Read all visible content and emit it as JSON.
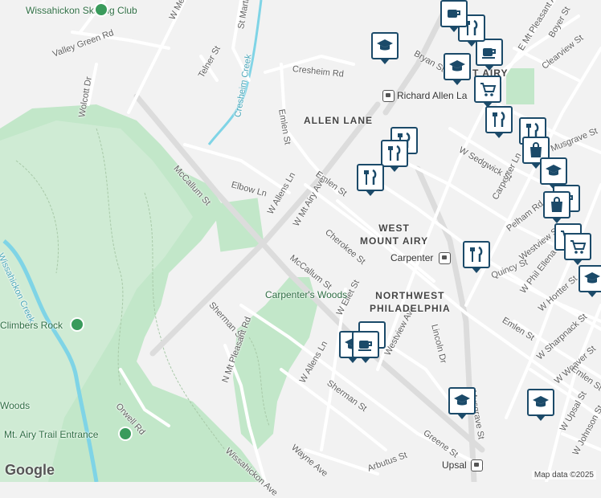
{
  "map": {
    "colors": {
      "park": "#c2e7c9",
      "park_light": "#d7efdc",
      "street": "#ffffff",
      "major": "#dcdcdc",
      "water": "#7fd4e6",
      "pin_border": "#1b4a69"
    },
    "streets": [
      "W Mermaid Ln",
      "St Martins Ln",
      "Valley Green Rd",
      "Telner St",
      "Wolcott Dr",
      "Cresheim Rd",
      "Emlen St",
      "Bryan St",
      "Boyer St",
      "Clearview St",
      "E Mt Pleasant Ave",
      "McCallum St",
      "Elbow Ln",
      "W Allens Ln",
      "W Mt Airy Ave",
      "Cherokee St",
      "Carpenter Ln",
      "W Sedgwick St",
      "Musgrave St",
      "Pelham Rd",
      "Westview St",
      "W Phil Ellena St",
      "Quincy St",
      "W Hortter St",
      "W Ellet St",
      "Sherman St",
      "Lincoln Dr",
      "N Mt Pleasant Rd",
      "Westview Ave",
      "Orwell Rd",
      "W Sharpnack St",
      "W Weaver St",
      "W Upsal St",
      "W Johnson St",
      "Greene St",
      "Arbutus St",
      "Wayne Ave",
      "Wissahickon Ave",
      "Cresheim Creek",
      "Wissahickon Creek"
    ],
    "neighborhoods": [
      "ALLEN LANE",
      "WEST MOUNT AIRY",
      "NORTHWEST PHILADELPHIA"
    ],
    "pois": [
      "Wissahickon Skating Club",
      "Carpenter's Woods",
      "Climbers Rock",
      "Mt. Airy Trail Entrance",
      "Woods"
    ],
    "transit": [
      "Richard Allen La",
      "Carpenter",
      "Upsal",
      "T AIRY"
    ],
    "attribution": "Map data ©2025",
    "logo": "Google"
  }
}
